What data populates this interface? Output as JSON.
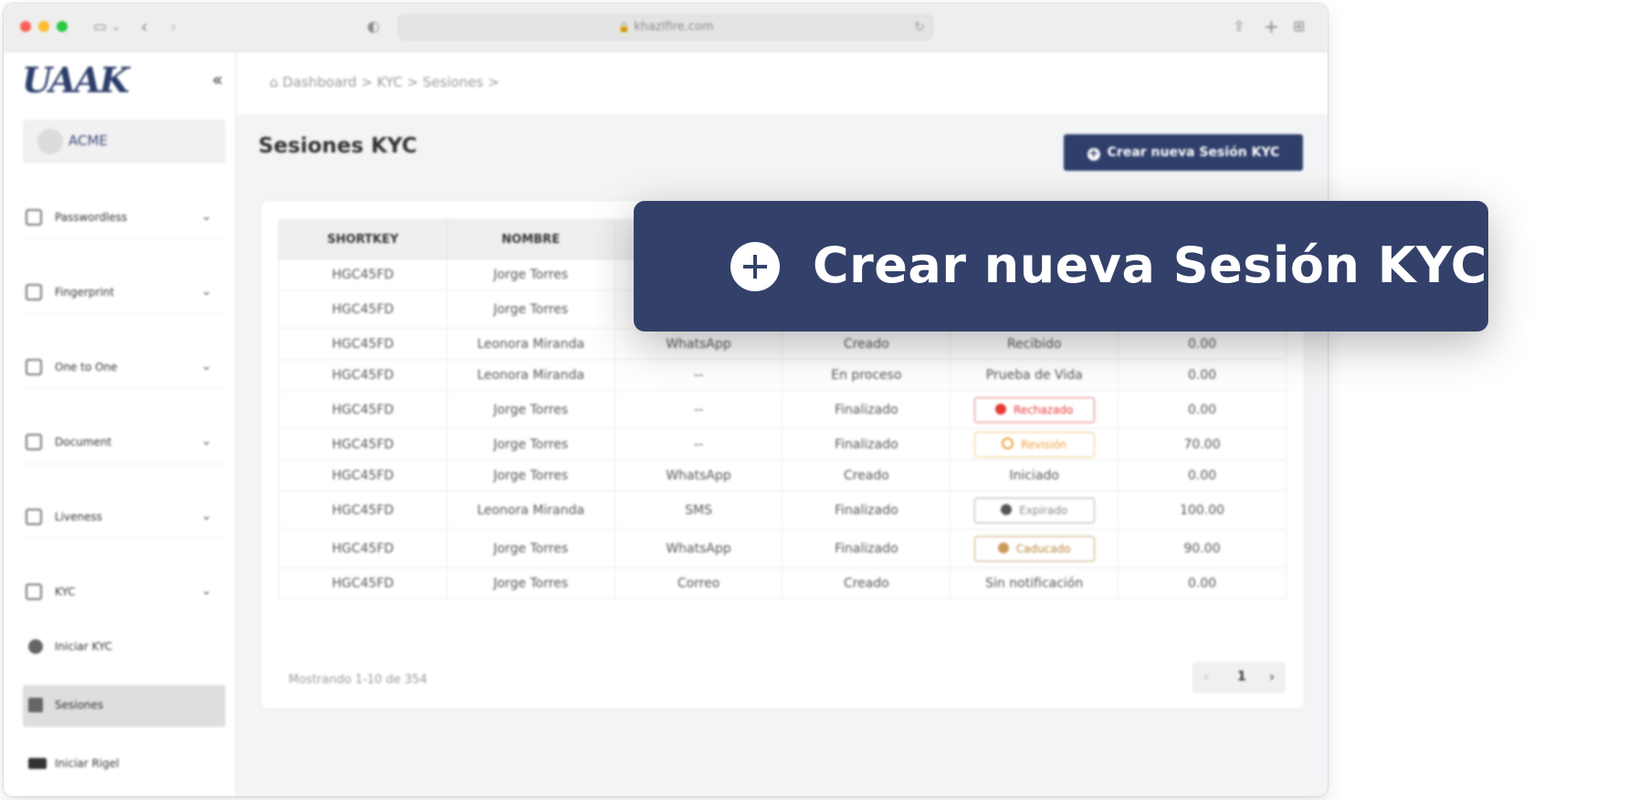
{
  "browser": {
    "url": "khazlfire.com"
  },
  "sidebar": {
    "logo": "UAAK",
    "org_name": "ACME",
    "items": [
      {
        "label": "Passwordless",
        "icon": "passwordless-icon"
      },
      {
        "label": "Fingerprint",
        "icon": "fingerprint-icon"
      },
      {
        "label": "One to One",
        "icon": "one-to-one-icon"
      },
      {
        "label": "Document",
        "icon": "document-icon"
      },
      {
        "label": "Liveness",
        "icon": "liveness-icon"
      },
      {
        "label": "KYC",
        "icon": "kyc-icon"
      }
    ],
    "sub_items": [
      {
        "label": "Iniciar KYC",
        "icon": "start-kyc-icon"
      },
      {
        "label": "Sesiones",
        "icon": "sessions-icon",
        "active": true
      },
      {
        "label": "Iniciar Rigel",
        "icon": "video-icon"
      }
    ]
  },
  "breadcrumb": {
    "text": "Dashboard > KYC > Sesiones >"
  },
  "page": {
    "title": "Sesiones KYC",
    "create_button": "Crear nueva Sesión KYC"
  },
  "table": {
    "headers": [
      "SHORTKEY",
      "NOMBRE",
      "",
      "",
      "",
      ""
    ],
    "rows": [
      [
        "HGC45FD",
        "Jorge Torres",
        "",
        "",
        "",
        ""
      ],
      [
        "HGC45FD",
        "Jorge Torres",
        "",
        "",
        "",
        ""
      ],
      [
        "HGC45FD",
        "Leonora Miranda",
        "WhatsApp",
        "Creado",
        "Recibido",
        "0.00"
      ],
      [
        "HGC45FD",
        "Leonora Miranda",
        "--",
        "En proceso",
        "Prueba de Vida",
        "0.00"
      ],
      [
        "HGC45FD",
        "Jorge Torres",
        "--",
        "Finalizado",
        "Rechazado",
        "0.00"
      ],
      [
        "HGC45FD",
        "Jorge Torres",
        "--",
        "Finalizado",
        "Revisión",
        "70.00"
      ],
      [
        "HGC45FD",
        "Jorge Torres",
        "WhatsApp",
        "Creado",
        "Iniciado",
        "0.00"
      ],
      [
        "HGC45FD",
        "Leonora Miranda",
        "SMS",
        "Finalizado",
        "Expirado",
        "100.00"
      ],
      [
        "HGC45FD",
        "Jorge Torres",
        "WhatsApp",
        "Finalizado",
        "Caducado",
        "90.00"
      ],
      [
        "HGC45FD",
        "Jorge Torres",
        "Correo",
        "Creado",
        "Sin notificación",
        "0.00"
      ]
    ],
    "row_heights": [
      34,
      42,
      34,
      34,
      42,
      34,
      34,
      42,
      42,
      34
    ],
    "badge_rows": {
      "4": "red",
      "5": "orange",
      "7": "gray",
      "8": "brown"
    }
  },
  "pagination": {
    "showing": "Mostrando 1-10 de 354",
    "current_page": "1"
  },
  "callout": {
    "text": "Crear nueva Sesión KYC"
  },
  "colors": {
    "primary": "#2f3f6b",
    "callout": "#33416a",
    "rejected": "#e53935",
    "review": "#f0a040",
    "expired": "#555555",
    "caducado": "#c79a5a"
  }
}
